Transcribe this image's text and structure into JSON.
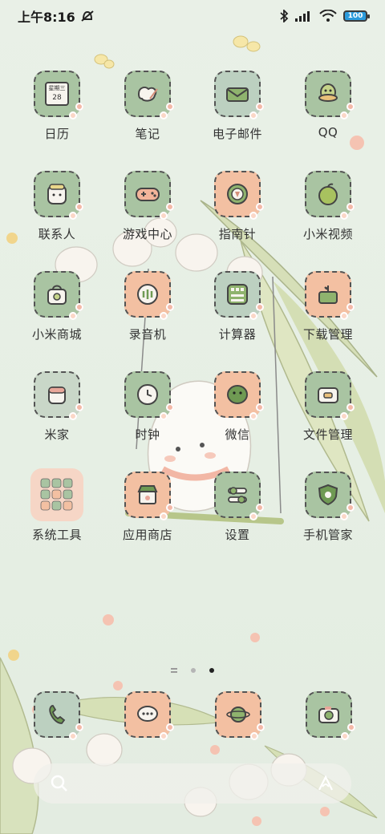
{
  "status_bar": {
    "time": "上午8:16",
    "battery": "100"
  },
  "apps": [
    {
      "label": "日历",
      "icon": "calendar-icon",
      "bg": "#a9c4a2",
      "badge": "星期三",
      "date": "28"
    },
    {
      "label": "笔记",
      "icon": "notes-icon",
      "bg": "#a9c4a2"
    },
    {
      "label": "电子邮件",
      "icon": "mail-icon",
      "bg": "#bcd0c0"
    },
    {
      "label": "QQ",
      "icon": "qq-icon",
      "bg": "#a9c4a2"
    },
    {
      "label": "联系人",
      "icon": "contacts-icon",
      "bg": "#a9c4a2"
    },
    {
      "label": "游戏中心",
      "icon": "gamepad-icon",
      "bg": "#a9c4a2"
    },
    {
      "label": "指南针",
      "icon": "compass-icon",
      "bg": "#f3c0a2"
    },
    {
      "label": "小米视频",
      "icon": "video-icon",
      "bg": "#a9c4a2"
    },
    {
      "label": "小米商城",
      "icon": "shopping-bag-icon",
      "bg": "#a9c4a2"
    },
    {
      "label": "录音机",
      "icon": "recorder-icon",
      "bg": "#f3c0a2"
    },
    {
      "label": "计算器",
      "icon": "calculator-icon",
      "bg": "#bcd0c0"
    },
    {
      "label": "下载管理",
      "icon": "download-icon",
      "bg": "#f3c0a2"
    },
    {
      "label": "米家",
      "icon": "home-device-icon",
      "bg": "#c9d7c8"
    },
    {
      "label": "时钟",
      "icon": "clock-icon",
      "bg": "#a9c4a2"
    },
    {
      "label": "微信",
      "icon": "wechat-icon",
      "bg": "#f3c0a2"
    },
    {
      "label": "文件管理",
      "icon": "folder-icon",
      "bg": "#a9c4a2"
    },
    {
      "label": "系统工具",
      "icon": "folder-grid-icon",
      "bg": "#f6d6c6"
    },
    {
      "label": "应用商店",
      "icon": "store-icon",
      "bg": "#f3c0a2"
    },
    {
      "label": "设置",
      "icon": "settings-icon",
      "bg": "#a9c4a2"
    },
    {
      "label": "手机管家",
      "icon": "shield-icon",
      "bg": "#a9c4a2"
    }
  ],
  "dock": [
    {
      "icon": "phone-icon",
      "bg": "#bcd0c0"
    },
    {
      "icon": "messages-icon",
      "bg": "#f3c0a2"
    },
    {
      "icon": "browser-icon",
      "bg": "#f3c0a2"
    },
    {
      "icon": "camera-icon",
      "bg": "#a9c4a2"
    }
  ],
  "colors": {
    "accent_green": "#a9c4a2",
    "accent_peach": "#f3c0a2",
    "outline": "#545454"
  }
}
